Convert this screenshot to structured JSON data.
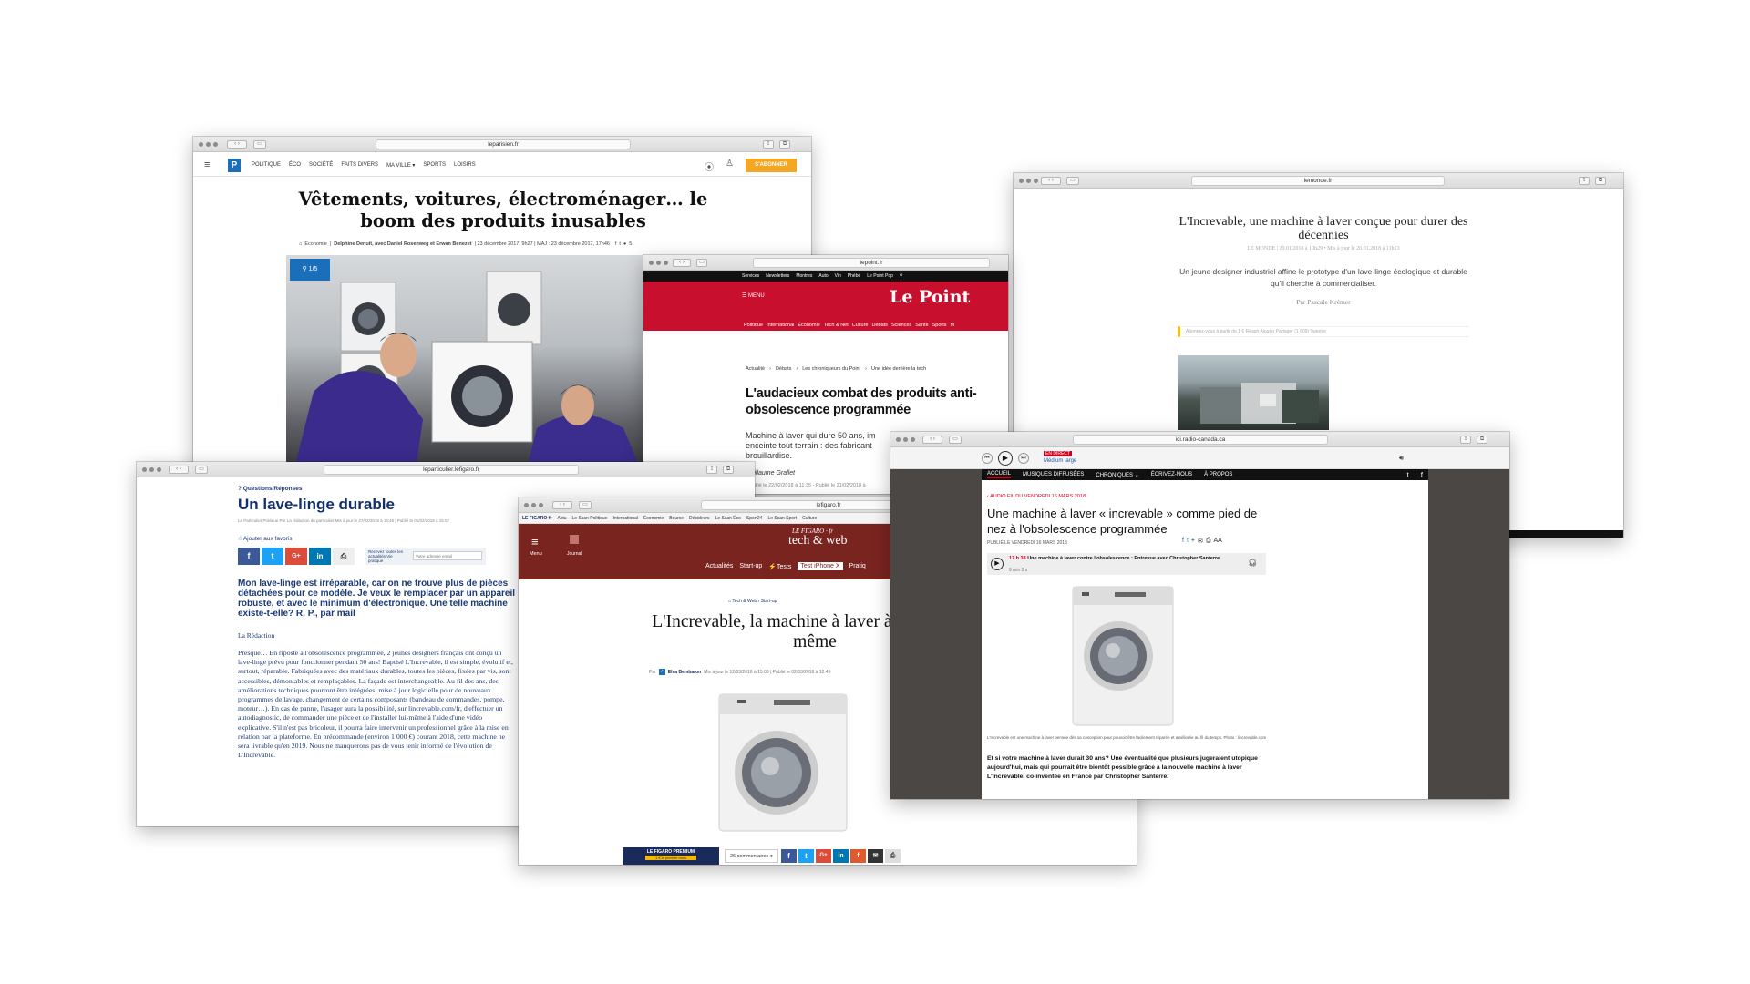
{
  "leparisien": {
    "url": "leparisien.fr",
    "logo": "P",
    "nav": [
      "POLITIQUE",
      "ÉCO",
      "SOCIÉTÉ",
      "FAITS DIVERS",
      "MA VILLE ▾",
      "SPORTS",
      "LOISIRS"
    ],
    "subscribe": "S'ABONNER",
    "title": "Vêtements, voitures, électroménager… le boom des produits inusables",
    "byline_cat": "Économie",
    "byline": "Delphine Denuit, avec Daniel Rosenweg et Erwan Benezet",
    "dates": "| 23 décembre 2017, 9h27 | MAJ : 23 décembre 2017, 17h46 |",
    "share_count": "5",
    "gallery": "1/5"
  },
  "lemonde": {
    "url": "lemonde.fr",
    "title": "L'Increvable, une machine à laver conçue pour durer des décennies",
    "meta": "LE MONDE | 20.01.2018 à 10h29 • Mis à jour le 20.01.2018 à 11h13",
    "lead": "Un jeune designer industriel affine le prototype d'un lave-linge écologique et durable qu'il cherche à commercialiser.",
    "author": "Par Pascale Krémer",
    "tools": "Abonnez-vous à partir de 1 €   Réagir   Ajouter      Partager (1 609)   Tweeter"
  },
  "lepoint": {
    "url": "lepoint.fr",
    "topnav": [
      "Services",
      "Newsletters",
      "Montres",
      "Auto",
      "Vin",
      "Phébé",
      "Le Point Pop"
    ],
    "menu": "MENU",
    "logo": "Le Point",
    "sections": [
      "Politique",
      "International",
      "Économie",
      "Tech & Net",
      "Culture",
      "Débats",
      "Sciences",
      "Santé",
      "Sports",
      "M"
    ],
    "breadcrumb": [
      "Actualité",
      "Débats",
      "Les chroniqueurs du Point",
      "Une idée derrière la tech"
    ],
    "title": "L'audacieux combat des produits anti-obsolescence programmée",
    "lead": "Machine à laver qui dure 50 ans, im enceinte tout terrain : des fabricant brouillardise.",
    "author": "Guillaume Grallet",
    "dates": "Modifié le 22/02/2018 à 11:35 - Publié le 21/02/2018 à"
  },
  "leparticulier": {
    "url": "leparticulier.lefigaro.fr",
    "kicker": "Questions/Réponses",
    "title": "Un lave-linge durable",
    "byline": "Le Particulier Pratique   Par La rédaction du particulier   Mis à jour le 27/02/2018 à 14:45 | Publié le 01/02/2018 à 15:57",
    "fav": "Ajouter aux favoris",
    "newsletter": "Recevez toutes les actualités Vie pratique",
    "email_placeholder": "Votre adresse email",
    "question": "Mon lave-linge est irréparable, car on ne trouve plus de pièces détachées pour ce modèle. Je veux le remplacer par un appareil robuste, et avec le minimum d'électronique. Une telle machine existe-t-elle? R. P., par mail",
    "redac": "La Rédaction",
    "body": "Presque… En riposte à l'obsolescence programmée, 2 jeunes designers français ont conçu un lave-linge prévu pour fonctionner pendant 50 ans! Baptisé L'Increvable, il est simple, évolutif et, surtout, réparable. Fabriquées avec des matériaux durables, toutes les pièces, fixées par vis, sont accessibles, démontables et remplaçables. La façade est interchangeable. Au fil des ans, des améliorations techniques pourront être intégrées: mise à jour logicielle pour de nouveaux programmes de lavage, changement de certains composants (bandeau de commandes, pompe, moteur…). En cas de panne, l'usager aura la possibilité, sur lincrevable.com/fr, d'effectuer un autodiagnostic, de commander une pièce et de l'installer lui-même à l'aide d'une vidéo explicative. S'il n'est pas bricoleur, il pourra faire intervenir un professionnel grâce à la mise en relation par la plateforme. En précommande (environ 1 000 €) courant 2018, cette machine ne sera livrable qu'en 2019. Nous ne manquerons pas de vous tenir informé de l'évolution de L'Increvable."
  },
  "lefigaro": {
    "url": "lefigaro.fr",
    "topnav": [
      "LE FIGARO·fr",
      "Actu",
      "Le Scan Politique",
      "International",
      "Économie",
      "Bourse",
      "Décideurs",
      "Le Scan Éco",
      "Sport24",
      "Le Scan Sport",
      "Culture"
    ],
    "menu": "Menu",
    "journal": "Journal",
    "logo_small": "LE FIGARO · fr",
    "logo": "tech & web",
    "sub": [
      "Actualités",
      "Start-up",
      "Tests",
      "Test iPhone X",
      "Pratiq"
    ],
    "breadcrumb": "Tech & Web  ›  Start-up",
    "title": "L'Increvable, la machine à laver à réparer soi-même",
    "byline_par": "Par",
    "author": "Elsa Bembaron",
    "dates": "Mis à jour le 12/03/2018 à 15:03  |  Publié le 02/03/2018 à 12:45",
    "premium": "LE FIGARO PREMIUM",
    "premium_sub": "1 € le premier mois",
    "comments": "26 commentaires"
  },
  "radiocanada": {
    "url": "ici.radio-canada.ca",
    "live": "EN DIRECT",
    "live_sub": "Médium large",
    "nav": [
      "ACCUEIL",
      "MUSIQUES DIFFUSÉES",
      "CHRONIQUES ⌄",
      "ÉCRIVEZ-NOUS",
      "À PROPOS"
    ],
    "kicker": "AUDIO FIL DU VENDREDI 16 MARS 2018",
    "title": "Une machine à laver « increvable » comme pied de nez à l'obsolescence programmée",
    "published": "PUBLIÉ LE VENDREDI 16 MARS 2018",
    "audio_time": "17 h 38",
    "audio_title": "Une machine à laver contre l'obsolescence : Entrevue avec Christopher Santerre",
    "audio_dur": "9 min 2 s",
    "caption": "L'Increvable est une machine à laver pensée dès sa conception pour pouvoir être facilement réparée et améliorée au fil du temps.   Photo : lincrevable.com",
    "body": "Et si votre machine à laver durait 30 ans? Une éventualité que plusieurs jugeraient utopique aujourd'hui, mais qui pourrait être bientôt possible grâce à la nouvelle machine à laver L'Increvable, co-inventée en France par Christopher Santerre."
  }
}
